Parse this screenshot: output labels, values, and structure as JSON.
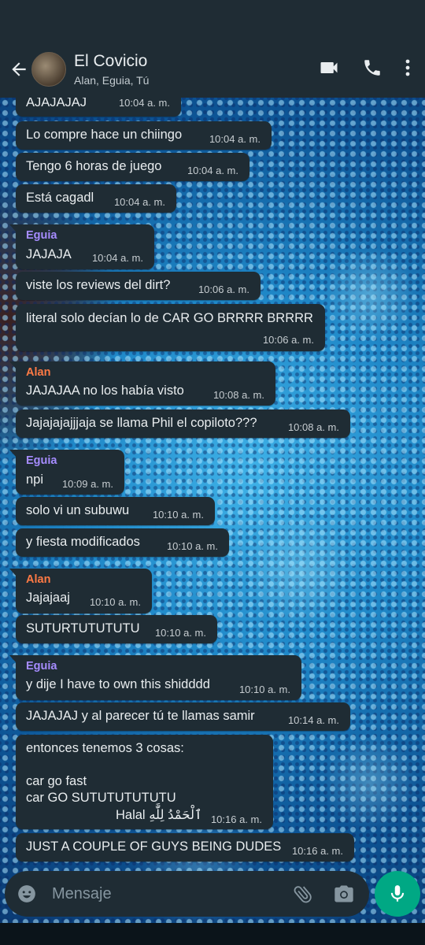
{
  "header": {
    "title": "El Covicio",
    "subtitle": "Alan, Eguia, Tú"
  },
  "icons": {
    "back": "arrow-left-icon",
    "video": "video-camera-icon",
    "call": "phone-icon",
    "menu": "more-vertical-icon",
    "emoji": "emoji-icon",
    "attach": "paperclip-icon",
    "camera": "camera-icon",
    "mic": "microphone-icon"
  },
  "colors": {
    "header_bg": "#1f2c34",
    "bubble_bg": "#1f2c34",
    "accent": "#00a884",
    "sender_eguia": "#a68cff",
    "sender_alan": "#ff7a45"
  },
  "messages": [
    {
      "text": "AJAJAJAJ",
      "time": "10:04 a. m."
    },
    {
      "text": "Lo compre hace un chiingo",
      "time": "10:04 a. m."
    },
    {
      "text": "Tengo 6 horas de juego",
      "time": "10:04 a. m."
    },
    {
      "text": "Está cagadl",
      "time": "10:04 a. m."
    },
    {
      "sender": "Eguia",
      "text": "JAJAJA",
      "time": "10:04 a. m."
    },
    {
      "text": "viste los reviews del dirt?",
      "time": "10:06 a. m."
    },
    {
      "text": "literal solo decían lo de CAR GO BRRRR BRRRR",
      "time": "10:06 a. m."
    },
    {
      "sender": "Alan",
      "text": "JAJAJAA no los había visto",
      "time": "10:08 a. m."
    },
    {
      "text": "Jajajajajjjaja se llama Phil el copiloto???",
      "time": "10:08 a. m."
    },
    {
      "sender": "Eguia",
      "text": "npi",
      "time": "10:09 a. m."
    },
    {
      "text": "solo vi un subuwu",
      "time": "10:10 a. m."
    },
    {
      "text": "y fiesta modificados",
      "time": "10:10 a. m."
    },
    {
      "sender": "Alan",
      "text": "Jajajaaj",
      "time": "10:10 a. m."
    },
    {
      "text": "SUTURTUTUTUTU",
      "time": "10:10 a. m."
    },
    {
      "sender": "Eguia",
      "text": "y dije I have to own this shidddd",
      "time": "10:10 a. m."
    },
    {
      "text": "JAJAJAJ y al parecer tú te llamas samir",
      "time": "10:14 a. m."
    },
    {
      "text": "entonces tenemos 3 cosas:\n\ncar go fast\ncar GO SUTUTUTUTUTU",
      "extra": "Halal ٱلْحَمْدُ لِلَّٰهِ",
      "time": "10:16 a. m."
    },
    {
      "text": "JUST A COUPLE OF GUYS BEING DUDES",
      "time": "10:16 a. m."
    }
  ],
  "composer": {
    "placeholder": "Mensaje"
  }
}
